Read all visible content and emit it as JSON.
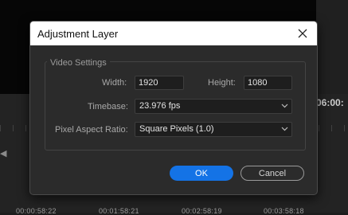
{
  "background": {
    "timecode_right": "06:00:",
    "timeline_timecodes": [
      "00:00:58:22",
      "00:01:58:21",
      "00:02:58:19",
      "00:03:58:18"
    ]
  },
  "dialog": {
    "title": "Adjustment Layer",
    "close_icon": "close-icon",
    "group_title": "Video Settings",
    "width_label": "Width:",
    "width_value": "1920",
    "height_label": "Height:",
    "height_value": "1080",
    "timebase_label": "Timebase:",
    "timebase_value": "23.976 fps",
    "pixel_aspect_label": "Pixel Aspect Ratio:",
    "pixel_aspect_value": "Square Pixels (1.0)",
    "ok_label": "OK",
    "cancel_label": "Cancel"
  },
  "colors": {
    "accent": "#1473e6",
    "dialog_bg": "#2b2b2b",
    "titlebar_bg": "#ffffff"
  }
}
